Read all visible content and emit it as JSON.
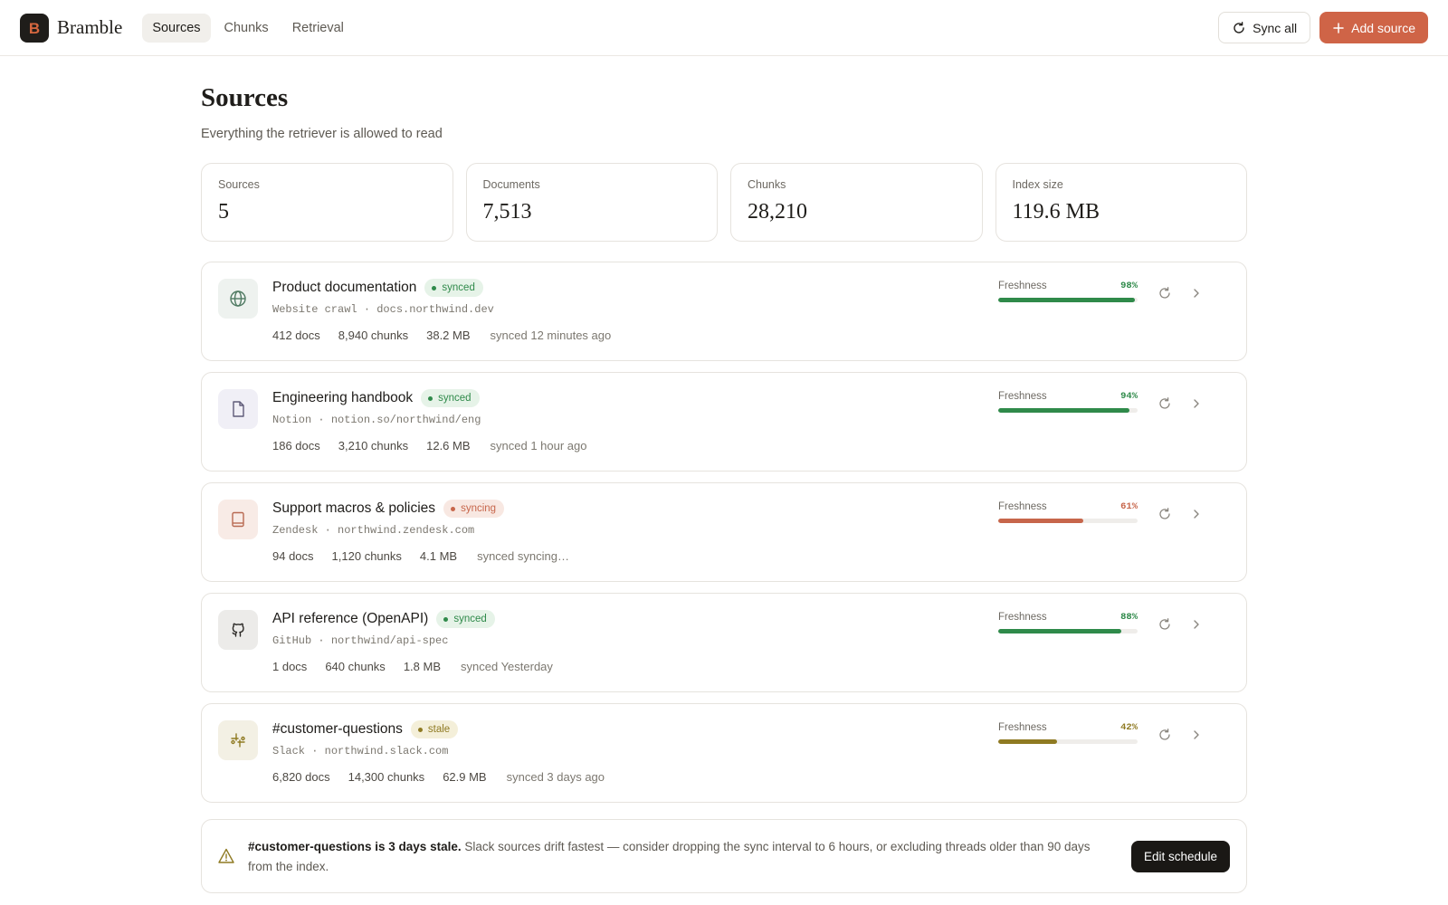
{
  "app": {
    "name": "Bramble",
    "logo_letter": "B"
  },
  "nav": {
    "tabs": [
      {
        "label": "Sources",
        "active": true
      },
      {
        "label": "Chunks",
        "active": false
      },
      {
        "label": "Retrieval",
        "active": false
      }
    ]
  },
  "toolbar": {
    "sync_all_label": "Sync all",
    "add_source_label": "Add source"
  },
  "page": {
    "title": "Sources",
    "subtitle": "Everything the retriever is allowed to read"
  },
  "stats": [
    {
      "label": "Sources",
      "value": "5"
    },
    {
      "label": "Documents",
      "value": "7,513"
    },
    {
      "label": "Chunks",
      "value": "28,210"
    },
    {
      "label": "Index size",
      "value": "119.6 MB"
    }
  ],
  "sources": [
    {
      "name": "Product documentation",
      "status": "synced",
      "type": "Website crawl",
      "location": "docs.northwind.dev",
      "docs": "412 docs",
      "chunks": "8,940 chunks",
      "size": "38.2 MB",
      "synced": "synced 12 minutes ago",
      "freshness_label": "Freshness",
      "freshness": 98,
      "freshness_text": "98%",
      "icon": "globe-icon"
    },
    {
      "name": "Engineering handbook",
      "status": "synced",
      "type": "Notion",
      "location": "notion.so/northwind/eng",
      "docs": "186 docs",
      "chunks": "3,210 chunks",
      "size": "12.6 MB",
      "synced": "synced 1 hour ago",
      "freshness_label": "Freshness",
      "freshness": 94,
      "freshness_text": "94%",
      "icon": "document-icon"
    },
    {
      "name": "Support macros & policies",
      "status": "syncing",
      "type": "Zendesk",
      "location": "northwind.zendesk.com",
      "docs": "94 docs",
      "chunks": "1,120 chunks",
      "size": "4.1 MB",
      "synced": "synced syncing…",
      "freshness_label": "Freshness",
      "freshness": 61,
      "freshness_text": "61%",
      "icon": "book-icon"
    },
    {
      "name": "API reference (OpenAPI)",
      "status": "synced",
      "type": "GitHub",
      "location": "northwind/api-spec",
      "docs": "1 docs",
      "chunks": "640 chunks",
      "size": "1.8 MB",
      "synced": "synced Yesterday",
      "freshness_label": "Freshness",
      "freshness": 88,
      "freshness_text": "88%",
      "icon": "github-icon"
    },
    {
      "name": "#customer-questions",
      "status": "stale",
      "type": "Slack",
      "location": "northwind.slack.com",
      "docs": "6,820 docs",
      "chunks": "14,300 chunks",
      "size": "62.9 MB",
      "synced": "synced 3 days ago",
      "freshness_label": "Freshness",
      "freshness": 42,
      "freshness_text": "42%",
      "icon": "slack-icon"
    }
  ],
  "alert": {
    "title": "#customer-questions is 3 days stale.",
    "body": "Slack sources drift fastest — consider dropping the sync interval to 6 hours, or excluding threads older than 90 days from the index.",
    "button_label": "Edit schedule"
  },
  "colors": {
    "accent": "#cf6447",
    "synced": "#2f8a4a",
    "syncing": "#c7664b",
    "stale": "#8f7a22",
    "synced_badge_bg": "#e6f3e8",
    "syncing_badge_bg": "#f8e8e2",
    "stale_badge_bg": "#f4efd9"
  }
}
